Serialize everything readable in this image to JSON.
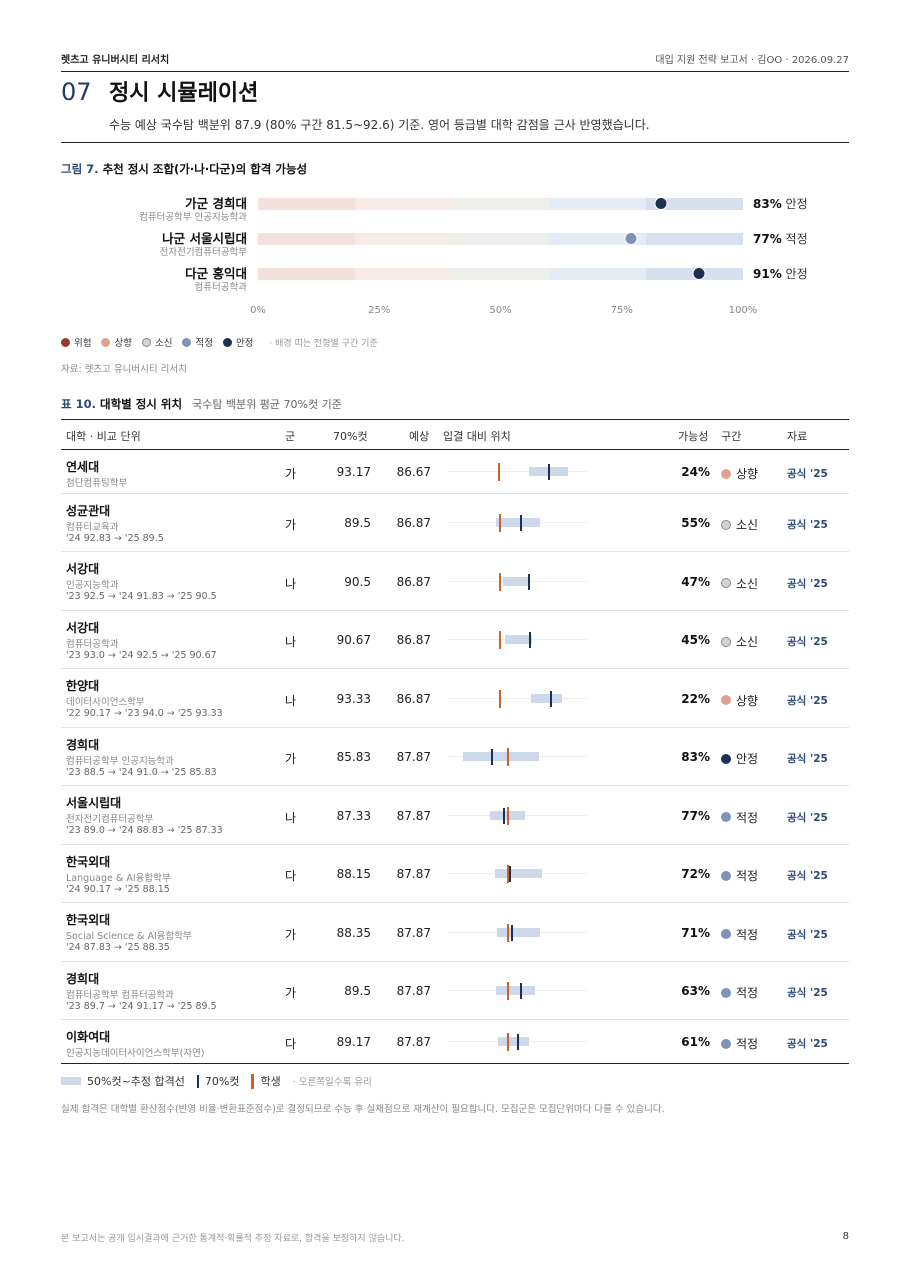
{
  "header": {
    "brand": "렛츠고 유니버시티 리서치",
    "meta": "대입 지원 전략 보고서 · 김OO · 2026.09.27"
  },
  "section": {
    "number": "07",
    "title": "정시 시뮬레이션",
    "subtitle": "수능 예상 국수탐 백분위 87.9 (80% 구간 81.5~92.6) 기준. 영어 등급별 대학 감점을 근사 반영했습니다."
  },
  "figure": {
    "label": "그림 7.",
    "title": "추천 정시 조합(가·나·다군)의 합격 가능성",
    "zone_colors": [
      "#f4e1dc",
      "#f6ebe6",
      "#eeeeea",
      "#e6ecf4",
      "#d6e0ee"
    ],
    "combos": [
      {
        "name": "가군 경희대",
        "unit": "컴퓨터공학부 인공지능학과",
        "pct_value": 83,
        "pct": "83%",
        "zone": "안정",
        "color": "#1d2f52"
      },
      {
        "name": "나군 서울시립대",
        "unit": "전자전기컴퓨터공학부",
        "pct_value": 77,
        "pct": "77%",
        "zone": "적정",
        "color": "#7d93b8"
      },
      {
        "name": "다군 홍익대",
        "unit": "컴퓨터공학과",
        "pct_value": 91,
        "pct": "91%",
        "zone": "안정",
        "color": "#1d2f52"
      }
    ],
    "axis_ticks": [
      "0%",
      "25%",
      "50%",
      "75%",
      "100%"
    ],
    "legend": [
      {
        "label": "위험",
        "color": "#9b3a2c"
      },
      {
        "label": "상향",
        "color": "#e0a08e"
      },
      {
        "label": "소신",
        "color": "#d4d4d4"
      },
      {
        "label": "적정",
        "color": "#7d93b8"
      },
      {
        "label": "안정",
        "color": "#1d2f52"
      }
    ],
    "legend_note": "· 배경 띠는 전형별 구간 기준",
    "source": "자료: 렛츠고 유니버시티 리서치"
  },
  "table": {
    "label": "표 10.",
    "title": "대학별 정시 위치",
    "subtitle": "국수탐 백분위 평균 70%컷 기준",
    "headers": {
      "univ": "대학 · 비교 단위",
      "group": "군",
      "cut70": "70%컷",
      "expected": "예상",
      "position": "입결 대비 위치",
      "chance": "가능성",
      "zone": "구간",
      "source": "자료"
    },
    "rows": [
      {
        "name": "연세대",
        "dept": "첨단컴퓨팅학부",
        "hist": "",
        "group": "가",
        "cut70": "93.17",
        "expected": "86.67",
        "lo": 90.5,
        "hi": 95.5,
        "cut_value": 93.17,
        "exp_value": 86.67,
        "chance": "24%",
        "zone": "상향",
        "zone_color": "#e0a08e",
        "source": "공식 '25"
      },
      {
        "name": "성균관대",
        "dept": "컴퓨터교육과",
        "hist": "'24 92.83 → '25 89.5",
        "group": "가",
        "cut70": "89.5",
        "expected": "86.87",
        "lo": 86.3,
        "hi": 92.0,
        "cut_value": 89.5,
        "exp_value": 86.87,
        "chance": "55%",
        "zone": "소신",
        "zone_color": "#d4d4d4",
        "source": "공식 '25"
      },
      {
        "name": "서강대",
        "dept": "인공지능학과",
        "hist": "'23 92.5 → '24 91.83 → '25 90.5",
        "group": "나",
        "cut70": "90.5",
        "expected": "86.87",
        "lo": 87.2,
        "hi": 90.5,
        "cut_value": 90.5,
        "exp_value": 86.87,
        "chance": "47%",
        "zone": "소신",
        "zone_color": "#d4d4d4",
        "source": "공식 '25"
      },
      {
        "name": "서강대",
        "dept": "컴퓨터공학과",
        "hist": "'23 93.0 → '24 92.5 → '25 90.67",
        "group": "나",
        "cut70": "90.67",
        "expected": "86.87",
        "lo": 87.5,
        "hi": 90.9,
        "cut_value": 90.67,
        "exp_value": 86.87,
        "chance": "45%",
        "zone": "소신",
        "zone_color": "#d4d4d4",
        "source": "공식 '25"
      },
      {
        "name": "한양대",
        "dept": "데이터사이언스학부",
        "hist": "'22 90.17 → '23 94.0 → '25 93.33",
        "group": "나",
        "cut70": "93.33",
        "expected": "86.87",
        "lo": 90.8,
        "hi": 94.8,
        "cut_value": 93.33,
        "exp_value": 86.87,
        "chance": "22%",
        "zone": "상향",
        "zone_color": "#e0a08e",
        "source": "공식 '25"
      },
      {
        "name": "경희대",
        "dept": "컴퓨터공학부 인공지능학과",
        "hist": "'23 88.5 → '24 91.0 → '25 85.83",
        "group": "가",
        "cut70": "85.83",
        "expected": "87.87",
        "lo": 82.0,
        "hi": 91.8,
        "cut_value": 85.83,
        "exp_value": 87.87,
        "chance": "83%",
        "zone": "안정",
        "zone_color": "#1d2f52",
        "source": "공식 '25"
      },
      {
        "name": "서울시립대",
        "dept": "전자전기컴퓨터공학부",
        "hist": "'23 89.0 → '24 88.83 → '25 87.33",
        "group": "나",
        "cut70": "87.33",
        "expected": "87.87",
        "lo": 85.5,
        "hi": 90.0,
        "cut_value": 87.33,
        "exp_value": 87.87,
        "chance": "77%",
        "zone": "적정",
        "zone_color": "#7d93b8",
        "source": "공식 '25"
      },
      {
        "name": "한국외대",
        "dept": "Language & AI융합학부",
        "hist": "'24 90.17 → '25 88.15",
        "group": "다",
        "cut70": "88.15",
        "expected": "87.87",
        "lo": 86.2,
        "hi": 92.2,
        "cut_value": 88.15,
        "exp_value": 87.87,
        "chance": "72%",
        "zone": "적정",
        "zone_color": "#7d93b8",
        "source": "공식 '25"
      },
      {
        "name": "한국외대",
        "dept": "Social Science & AI융합학부",
        "hist": "'24 87.83 → '25 88.35",
        "group": "가",
        "cut70": "88.35",
        "expected": "87.87",
        "lo": 86.4,
        "hi": 92.0,
        "cut_value": 88.35,
        "exp_value": 87.87,
        "chance": "71%",
        "zone": "적정",
        "zone_color": "#7d93b8",
        "source": "공식 '25"
      },
      {
        "name": "경희대",
        "dept": "컴퓨터공학부 컴퓨터공학과",
        "hist": "'23 89.7 → '24 91.17 → '25 89.5",
        "group": "가",
        "cut70": "89.5",
        "expected": "87.87",
        "lo": 86.3,
        "hi": 91.3,
        "cut_value": 89.5,
        "exp_value": 87.87,
        "chance": "63%",
        "zone": "적정",
        "zone_color": "#7d93b8",
        "source": "공식 '25"
      },
      {
        "name": "이화여대",
        "dept": "인공지능데이터사이언스학부(자연)",
        "hist": "",
        "group": "다",
        "cut70": "89.17",
        "expected": "87.87",
        "lo": 86.6,
        "hi": 90.6,
        "cut_value": 89.17,
        "exp_value": 87.87,
        "chance": "61%",
        "zone": "적정",
        "zone_color": "#7d93b8",
        "source": "공식 '25"
      }
    ],
    "legend": {
      "range": "50%컷~추정 합격선",
      "cut70": "70%컷",
      "student": "학생",
      "note": "· 오른쪽일수록 유리"
    },
    "footnote": "실제 합격은 대학별 환산점수(반영 비율·변환표준점수)로 결정되므로 수능 후 실채점으로 재계산이 필요합니다. 모집군은 모집단위마다 다를 수 있습니다."
  },
  "footer": {
    "disclaimer": "본 보고서는 공개 입시결과에 근거한 통계적·확률적 추정 자료로, 합격을 보장하지 않습니다.",
    "page": "8"
  }
}
